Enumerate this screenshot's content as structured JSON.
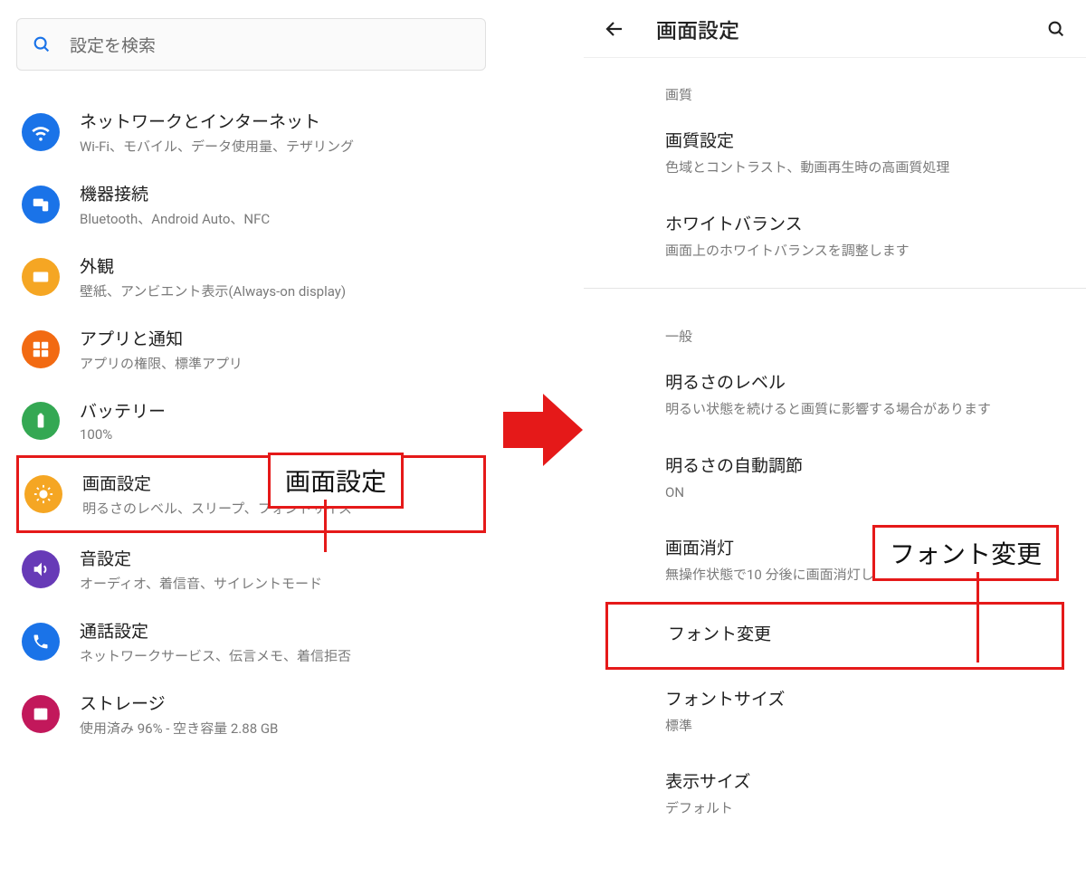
{
  "left": {
    "search_placeholder": "設定を検索",
    "items": [
      {
        "title": "ネットワークとインターネット",
        "sub": "Wi-Fi、モバイル、データ使用量、テザリング",
        "color": "#1a73e8",
        "icon": "wifi"
      },
      {
        "title": "機器接続",
        "sub": "Bluetooth、Android Auto、NFC",
        "color": "#1a73e8",
        "icon": "devices"
      },
      {
        "title": "外観",
        "sub": "壁紙、アンビエント表示(Always-on display)",
        "color": "#f5a623",
        "icon": "panorama"
      },
      {
        "title": "アプリと通知",
        "sub": "アプリの権限、標準アプリ",
        "color": "#f26a12",
        "icon": "apps"
      },
      {
        "title": "バッテリー",
        "sub": "100%",
        "color": "#34a853",
        "icon": "battery"
      },
      {
        "title": "画面設定",
        "sub": "明るさのレベル、スリープ、フォントサイズ",
        "color": "#f5a623",
        "icon": "brightness",
        "highlight": true
      },
      {
        "title": "音設定",
        "sub": "オーディオ、着信音、サイレントモード",
        "color": "#673ab7",
        "icon": "volume"
      },
      {
        "title": "通話設定",
        "sub": "ネットワークサービス、伝言メモ、着信拒否",
        "color": "#1a73e8",
        "icon": "phone"
      },
      {
        "title": "ストレージ",
        "sub": "使用済み 96% - 空き容量 2.88 GB",
        "color": "#c2185b",
        "icon": "storage"
      }
    ]
  },
  "right": {
    "title": "画面設定",
    "sections": [
      {
        "label": "画質",
        "items": [
          {
            "title": "画質設定",
            "sub": "色域とコントラスト、動画再生時の高画質処理"
          },
          {
            "title": "ホワイトバランス",
            "sub": "画面上のホワイトバランスを調整します"
          }
        ]
      },
      {
        "label": "一般",
        "items": [
          {
            "title": "明るさのレベル",
            "sub": "明るい状態を続けると画質に影響する場合があります"
          },
          {
            "title": "明るさの自動調節",
            "sub": "ON"
          },
          {
            "title": "画面消灯",
            "sub": "無操作状態で10 分後に画面消灯します"
          },
          {
            "title": "フォント変更",
            "sub": "",
            "highlight": true
          },
          {
            "title": "フォントサイズ",
            "sub": "標準"
          },
          {
            "title": "表示サイズ",
            "sub": "デフォルト"
          }
        ]
      }
    ]
  },
  "callouts": {
    "left": "画面設定",
    "right": "フォント変更"
  },
  "icons": {
    "wifi": "wifi-icon",
    "devices": "devices-icon",
    "panorama": "panorama-icon",
    "apps": "apps-icon",
    "battery": "battery-icon",
    "brightness": "brightness-icon",
    "volume": "volume-icon",
    "phone": "phone-icon",
    "storage": "storage-icon"
  }
}
